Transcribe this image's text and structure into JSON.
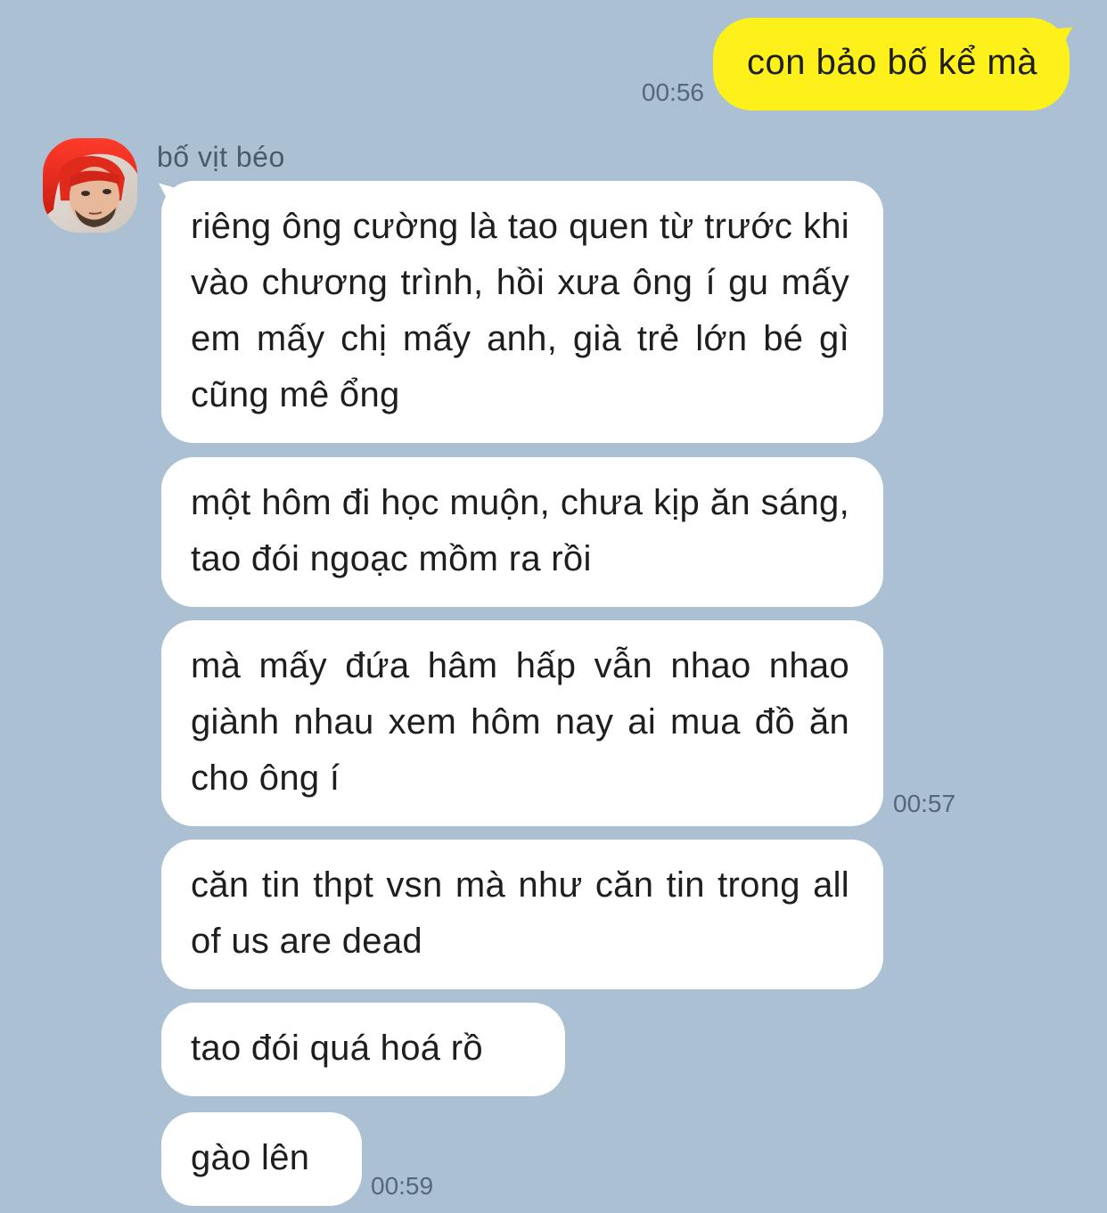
{
  "outgoing": [
    {
      "text": "con bảo bố kể mà",
      "time": "00:56"
    }
  ],
  "contact": {
    "name": "bố vịt béo",
    "avatar_icon": "avatar-photo-red-hair"
  },
  "incoming": [
    {
      "text": "riêng ông cường là tao quen từ trước khi vào chương trình, hồi xưa ông í gu mấy em mấy chị mấy anh, già trẻ lớn bé gì cũng mê ổng",
      "time": ""
    },
    {
      "text": "một hôm đi học muộn, chưa kịp ăn sáng, tao đói ngoạc mồm ra rồi",
      "time": ""
    },
    {
      "text": "mà mấy đứa hâm hấp vẫn nhao nhao giành nhau xem hôm nay ai mua đồ ăn cho ông í",
      "time": "00:57"
    },
    {
      "text": "căn tin thpt vsn mà như căn tin trong all of us are dead",
      "time": ""
    },
    {
      "text": "tao đói quá hoá rồ",
      "time": ""
    },
    {
      "text": "gào lên",
      "time": "00:59"
    }
  ],
  "colors": {
    "background": "#abc1d3",
    "outgoing_bubble": "#fef01b",
    "incoming_bubble": "#ffffff",
    "timestamp": "#55677a"
  }
}
